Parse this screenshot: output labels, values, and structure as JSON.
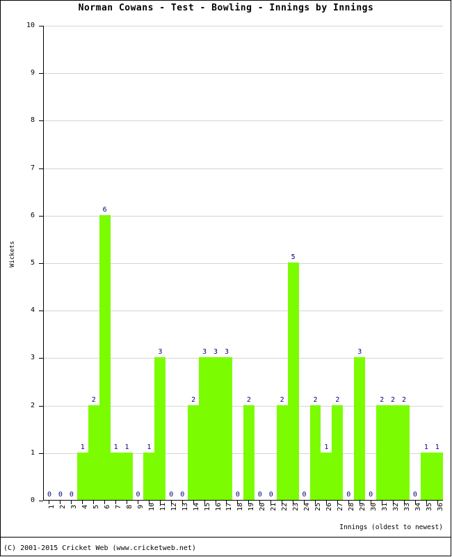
{
  "chart_data": {
    "type": "bar",
    "title": "Norman Cowans - Test - Bowling - Innings by Innings",
    "xlabel": "Innings (oldest to newest)",
    "ylabel": "Wickets",
    "ylim": [
      0,
      10
    ],
    "yticks": [
      0,
      1,
      2,
      3,
      4,
      5,
      6,
      7,
      8,
      9,
      10
    ],
    "grid": true,
    "legend": "none",
    "bar_color": "#7CFC00",
    "label_color": "#000080",
    "categories": [
      "1",
      "2",
      "3",
      "4",
      "5",
      "6",
      "7",
      "8",
      "9",
      "10",
      "11",
      "12",
      "13",
      "14",
      "15",
      "16",
      "17",
      "18",
      "19",
      "20",
      "21",
      "22",
      "23",
      "24",
      "25",
      "26",
      "27",
      "28",
      "29",
      "30",
      "31",
      "32",
      "33",
      "34",
      "35",
      "36"
    ],
    "values": [
      0,
      0,
      0,
      1,
      2,
      6,
      1,
      1,
      0,
      1,
      3,
      0,
      0,
      2,
      3,
      3,
      3,
      0,
      2,
      0,
      0,
      2,
      5,
      0,
      2,
      1,
      2,
      0,
      3,
      0,
      2,
      2,
      2,
      0,
      1,
      1
    ]
  },
  "footer": {
    "copyright": "(C) 2001-2015 Cricket Web (www.cricketweb.net)"
  }
}
